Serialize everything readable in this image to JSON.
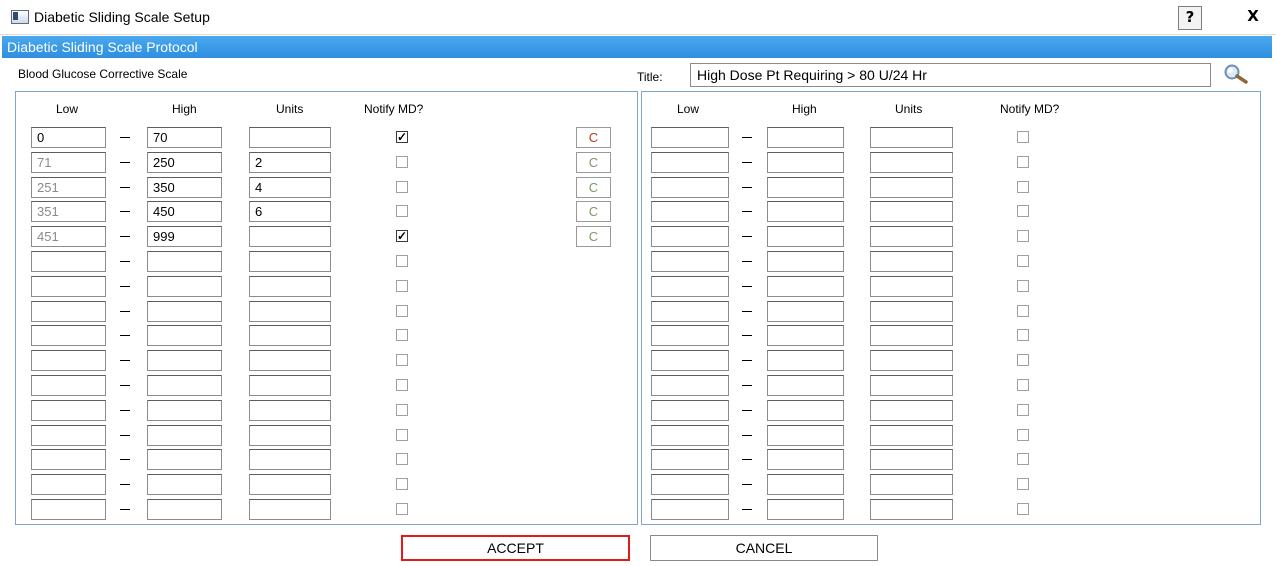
{
  "window": {
    "title": "Diabetic Sliding Scale Setup",
    "help_label": "?",
    "close_label": "X"
  },
  "protocol_header": "Diabetic Sliding Scale Protocol",
  "scale_label": "Blood Glucose Corrective Scale",
  "title_label": "Title:",
  "title_value": "High Dose Pt Requiring > 80 U/24 Hr",
  "columns": {
    "low": "Low",
    "high": "High",
    "units": "Units",
    "notify": "Notify MD?"
  },
  "left_rows": [
    {
      "low": "0",
      "high": "70",
      "units": "",
      "notify": true,
      "c": "C"
    },
    {
      "low": "71",
      "high": "250",
      "units": "2",
      "notify": false,
      "c": "C"
    },
    {
      "low": "251",
      "high": "350",
      "units": "4",
      "notify": false,
      "c": "C"
    },
    {
      "low": "351",
      "high": "450",
      "units": "6",
      "notify": false,
      "c": "C"
    },
    {
      "low": "451",
      "high": "999",
      "units": "",
      "notify": true,
      "c": "C"
    },
    {
      "low": "",
      "high": "",
      "units": "",
      "notify": false
    },
    {
      "low": "",
      "high": "",
      "units": "",
      "notify": false
    },
    {
      "low": "",
      "high": "",
      "units": "",
      "notify": false
    },
    {
      "low": "",
      "high": "",
      "units": "",
      "notify": false
    },
    {
      "low": "",
      "high": "",
      "units": "",
      "notify": false
    },
    {
      "low": "",
      "high": "",
      "units": "",
      "notify": false
    },
    {
      "low": "",
      "high": "",
      "units": "",
      "notify": false
    },
    {
      "low": "",
      "high": "",
      "units": "",
      "notify": false
    },
    {
      "low": "",
      "high": "",
      "units": "",
      "notify": false
    },
    {
      "low": "",
      "high": "",
      "units": "",
      "notify": false
    },
    {
      "low": "",
      "high": "",
      "units": "",
      "notify": false
    }
  ],
  "right_rows": [
    {
      "low": "",
      "high": "",
      "units": "",
      "notify": false
    },
    {
      "low": "",
      "high": "",
      "units": "",
      "notify": false
    },
    {
      "low": "",
      "high": "",
      "units": "",
      "notify": false
    },
    {
      "low": "",
      "high": "",
      "units": "",
      "notify": false
    },
    {
      "low": "",
      "high": "",
      "units": "",
      "notify": false
    },
    {
      "low": "",
      "high": "",
      "units": "",
      "notify": false
    },
    {
      "low": "",
      "high": "",
      "units": "",
      "notify": false
    },
    {
      "low": "",
      "high": "",
      "units": "",
      "notify": false
    },
    {
      "low": "",
      "high": "",
      "units": "",
      "notify": false
    },
    {
      "low": "",
      "high": "",
      "units": "",
      "notify": false
    },
    {
      "low": "",
      "high": "",
      "units": "",
      "notify": false
    },
    {
      "low": "",
      "high": "",
      "units": "",
      "notify": false
    },
    {
      "low": "",
      "high": "",
      "units": "",
      "notify": false
    },
    {
      "low": "",
      "high": "",
      "units": "",
      "notify": false
    },
    {
      "low": "",
      "high": "",
      "units": "",
      "notify": false
    },
    {
      "low": "",
      "high": "",
      "units": "",
      "notify": false
    }
  ],
  "buttons": {
    "accept": "ACCEPT",
    "cancel": "CANCEL"
  },
  "colors": {
    "protocol_bar": "#3399e8",
    "accept_border": "#e21a1a",
    "c_active": "#b3401a",
    "c_inactive": "#7a9a6a"
  },
  "icons": {
    "window": "window-app-icon",
    "search": "magnifier-icon"
  }
}
